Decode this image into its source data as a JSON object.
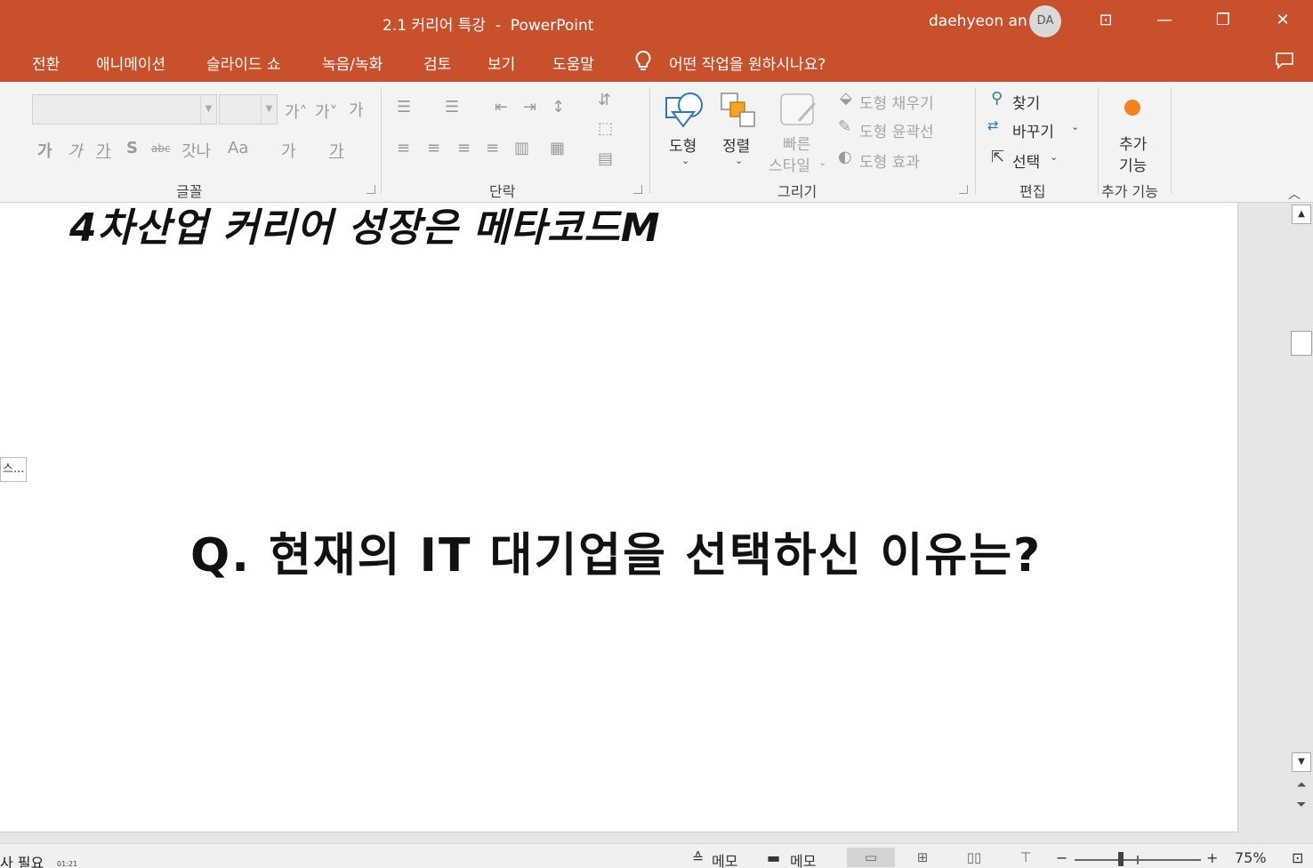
{
  "window": {
    "title": "2.1 커리어 특강  -  PowerPoint",
    "user_name": "daehyeon an",
    "avatar_initials": "DA",
    "controls": {
      "ribbon_display": "⊡",
      "minimize": "—",
      "restore": "❐",
      "close": "✕"
    }
  },
  "menu": {
    "tabs": [
      "전환",
      "애니메이션",
      "슬라이드 쇼",
      "녹음/녹화",
      "검토",
      "보기",
      "도움말"
    ],
    "tell_me": "어떤 작업을 원하시나요?",
    "comment_icon": "comment-icon"
  },
  "ribbon": {
    "font_group": {
      "label": "글꼴",
      "font_name_value": "",
      "font_size_value": "",
      "grow_font": "가˄",
      "shrink_font": "가˅",
      "clear_format": "가",
      "bold": "가",
      "italic": "가",
      "underline": "가",
      "shadow": "S",
      "strike": "abc",
      "char_spacing": "갓나",
      "change_case": "Aa",
      "highlight": "가",
      "font_color": "가"
    },
    "paragraph_group": {
      "label": "단락"
    },
    "drawing_group": {
      "label": "그리기",
      "shapes": "도형",
      "arrange": "정렬",
      "quick_styles_line1": "빠른",
      "quick_styles_line2": "스타일",
      "shape_fill": "도형 채우기",
      "shape_outline": "도형 윤곽선",
      "shape_effects": "도형 효과"
    },
    "editing_group": {
      "label": "편집",
      "find": "찾기",
      "replace": "바꾸기",
      "select": "선택"
    },
    "addins_group": {
      "label": "추가 기능",
      "button_line1": "추가",
      "button_line2": "기능",
      "accent": "#f5821f"
    }
  },
  "slide": {
    "heading": "4차산업 커리어 성장은 메타코드M",
    "question": "Q. 현재의 IT 대기업을 선택하신 이유는?",
    "side_tab": "스..."
  },
  "statusbar": {
    "left_text": "사 필요",
    "time": "01:21",
    "notes": "메모",
    "comments": "메모",
    "zoom_minus": "−",
    "zoom_plus": "+",
    "zoom": "75%"
  },
  "colors": {
    "title_bar": "#c8502b",
    "ribbon_bg": "#f3f3f3",
    "workspace_bg": "#e6e6e6"
  }
}
